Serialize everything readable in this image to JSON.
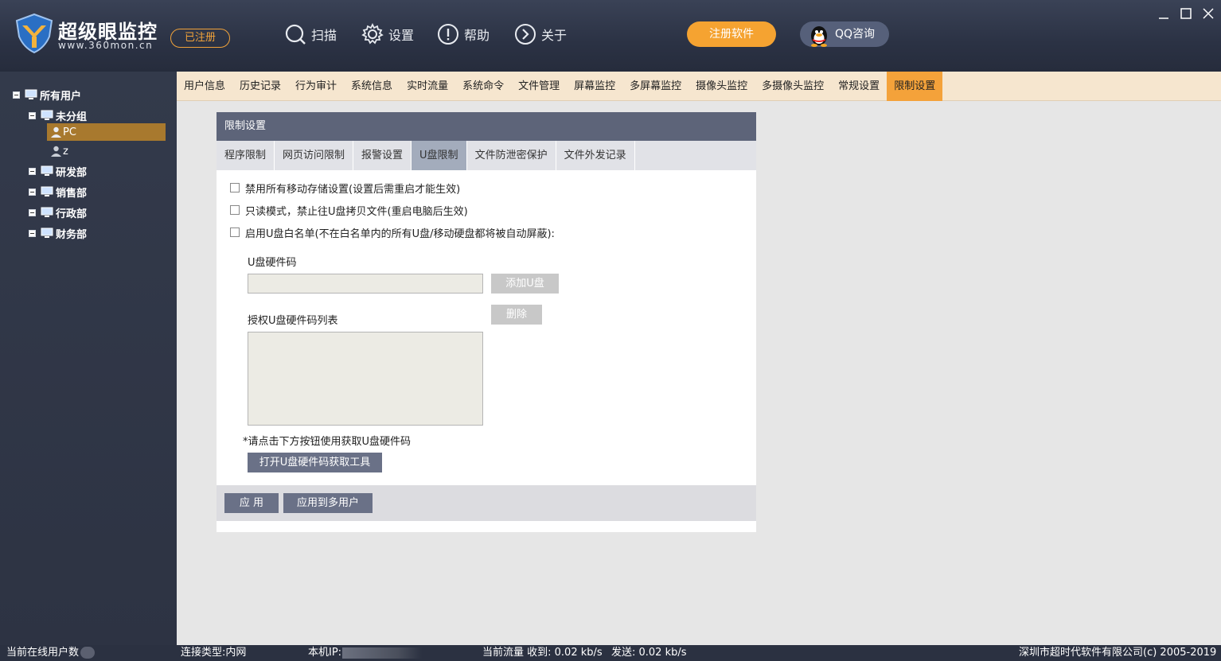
{
  "header": {
    "brand_name": "超级眼监控",
    "brand_url": "www.360mon.cn",
    "registered_badge": "已注册",
    "nav": [
      {
        "label": "扫描",
        "icon": "search-icon"
      },
      {
        "label": "设置",
        "icon": "gear-icon"
      },
      {
        "label": "帮助",
        "icon": "exclamation-icon"
      },
      {
        "label": "关于",
        "icon": "chevron-right-icon"
      }
    ],
    "register_label": "注册软件",
    "qq_label": "QQ咨询"
  },
  "sidebar": {
    "root": "所有用户",
    "groups": [
      "未分组",
      "研发部",
      "销售部",
      "行政部",
      "财务部"
    ],
    "users": [
      "PC",
      "z"
    ]
  },
  "tabs": [
    "用户信息",
    "历史记录",
    "行为审计",
    "系统信息",
    "实时流量",
    "系统命令",
    "文件管理",
    "屏幕监控",
    "多屏幕监控",
    "摄像头监控",
    "多摄像头监控",
    "常规设置",
    "限制设置"
  ],
  "active_tab_index": 12,
  "panel": {
    "title": "限制设置",
    "sub_tabs": [
      "程序限制",
      "网页访问限制",
      "报警设置",
      "U盘限制",
      "文件防泄密保护",
      "文件外发记录"
    ],
    "active_sub_tab_index": 3,
    "checkbox_1": "禁用所有移动存储设置(设置后需重启才能生效)",
    "checkbox_2": "只读模式，禁止往U盘拷贝文件(重启电脑后生效)",
    "checkbox_3": "启用U盘白名单(不在白名单内的所有U盘/移动硬盘都将被自动屏蔽):",
    "u_code_label": "U盘硬件码",
    "add_u_label": "添加U盘",
    "delete_label": "删除",
    "list_label": "授权U盘硬件码列表",
    "hint": "*请点击下方按钮使用获取U盘硬件码",
    "open_tool_label": "打开U盘硬件码获取工具",
    "apply_label": "应 用",
    "apply_multi_label": "应用到多用户"
  },
  "status": {
    "online_users": "当前在线用户数",
    "connection": "连接类型:内网",
    "local_ip": "本机IP:",
    "traffic_recv": "当前流量 收到: 0.02 kb/s",
    "traffic_send": "发送: 0.02 kb/s",
    "copyright": "深圳市超时代软件有限公司(c) 2005-2019"
  },
  "colors": {
    "accent": "#f4a23a",
    "header_bg": "#2b3244",
    "panel_header": "#5d6479",
    "button": "#6a7187"
  }
}
